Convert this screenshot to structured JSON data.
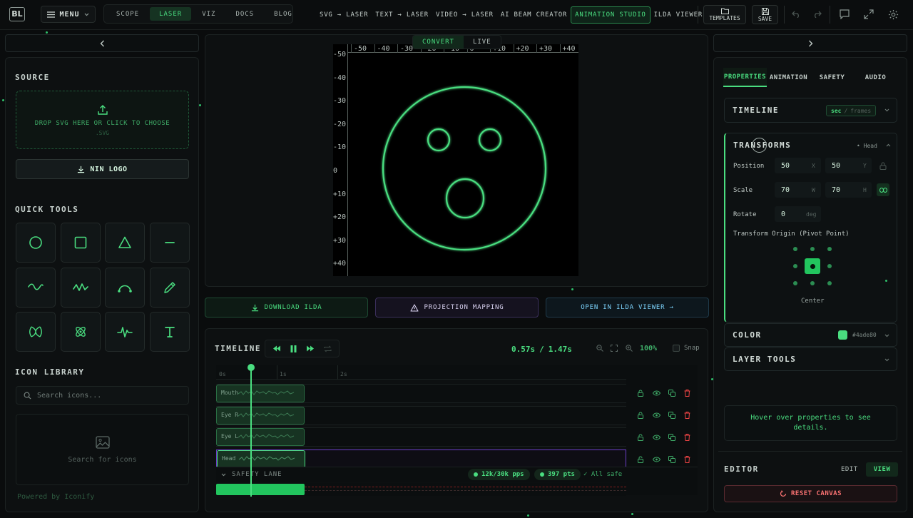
{
  "app": {
    "logo_text": "BL",
    "menu_label": "MENU"
  },
  "nav": [
    {
      "label": "SCOPE",
      "active": false
    },
    {
      "label": "LASER",
      "active": true
    },
    {
      "label": "VIZ",
      "active": false
    },
    {
      "label": "DOCS",
      "active": false
    },
    {
      "label": "BLOG",
      "active": false
    }
  ],
  "modes": [
    {
      "label": "SVG → LASER",
      "active": false
    },
    {
      "label": "TEXT → LASER",
      "active": false
    },
    {
      "label": "VIDEO → LASER",
      "active": false
    },
    {
      "label": "AI BEAM CREATOR",
      "active": false
    },
    {
      "label": "ANIMATION STUDIO",
      "active": true
    },
    {
      "label": "ILDA VIEWER",
      "active": false
    }
  ],
  "toolbar": {
    "templates_label": "TEMPLATES",
    "save_label": "SAVE"
  },
  "left": {
    "source_title": "SOURCE",
    "drop_text": "DROP SVG HERE OR CLICK TO CHOOSE",
    "drop_sub": ".SVG",
    "nin_logo_label": "NIN LOGO",
    "quick_tools_title": "QUICK TOOLS",
    "tools": [
      "circle",
      "square",
      "triangle",
      "line",
      "sine-wave",
      "zigzag",
      "arc",
      "pencil",
      "lissajous",
      "atom",
      "pulse",
      "text"
    ],
    "icon_library_title": "ICON LIBRARY",
    "search_placeholder": "Search icons...",
    "search_results_text": "Search for icons",
    "powered_by": "Powered by Iconify"
  },
  "canvas": {
    "mode_toggle": [
      {
        "label": "CONVERT",
        "active": true
      },
      {
        "label": "LIVE",
        "active": false
      }
    ],
    "ruler_x": [
      "-50",
      "-40",
      "-30",
      "-20",
      "-10",
      "0",
      "+10",
      "+20",
      "+30",
      "+40"
    ],
    "ruler_y": [
      "-50",
      "-40",
      "-30",
      "-20",
      "-10",
      "0",
      "+10",
      "+20",
      "+30",
      "+40"
    ],
    "beam_color": "#4ade80"
  },
  "actions": {
    "download_label": "DOWNLOAD ILDA",
    "projection_label": "PROJECTION MAPPING",
    "open_viewer_label": "OPEN IN ILDA VIEWER →"
  },
  "timeline": {
    "title": "TIMELINE",
    "time_current": "0.57s",
    "time_sep": "/",
    "time_total": "1.47s",
    "zoom": "100%",
    "snap_label": "Snap",
    "snap_checked": false,
    "ruler_marks": [
      "0s",
      "1s",
      "2s"
    ],
    "playhead_seconds": 0.57,
    "tracks": [
      {
        "name": "Mouth"
      },
      {
        "name": "Eye R"
      },
      {
        "name": "Eye L"
      },
      {
        "name": "Head"
      }
    ],
    "safety_lane_label": "SAFETY LANE",
    "pps_badge": "12k/30k pps",
    "pts_badge": "397 pts",
    "all_safe": "✓ All safe"
  },
  "right": {
    "tabs": [
      {
        "label": "PROPERTIES",
        "active": true
      },
      {
        "label": "ANIMATION",
        "active": false
      },
      {
        "label": "SAFETY",
        "active": false
      },
      {
        "label": "AUDIO",
        "active": false
      }
    ],
    "timeline_section": {
      "title": "TIMELINE",
      "unit_on": "sec",
      "unit_sep": "/",
      "unit_off": "frames"
    },
    "transforms": {
      "title": "TRANSFORMS",
      "target": "• Head",
      "position_label": "Position",
      "pos_x": "50",
      "pos_x_unit": "X",
      "pos_y": "50",
      "pos_y_unit": "Y",
      "scale_label": "Scale",
      "scale_w": "70",
      "scale_w_unit": "W",
      "scale_h": "70",
      "scale_h_unit": "H",
      "rotate_label": "Rotate",
      "rotate": "0",
      "rotate_unit": "deg",
      "origin_label": "Transform Origin (Pivot Point)",
      "origin_value": "Center"
    },
    "color": {
      "title": "COLOR",
      "value": "#4ade80"
    },
    "layer_tools_title": "LAYER TOOLS",
    "hint_text": "Hover over properties to see details.",
    "editor_title": "EDITOR",
    "editor_modes": [
      {
        "label": "EDIT",
        "active": false
      },
      {
        "label": "VIEW",
        "active": true
      }
    ],
    "reset_label": "RESET CANVAS"
  }
}
